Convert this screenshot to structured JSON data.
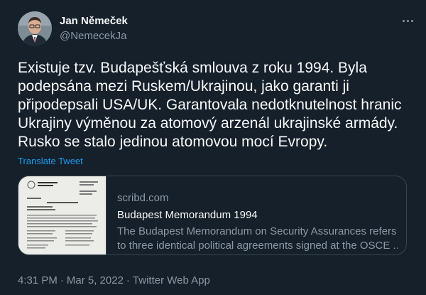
{
  "author": {
    "name": "Jan Němeček",
    "handle": "@NemecekJa"
  },
  "tweet": {
    "text": "Existuje tzv. Budapešťská smlouva z roku 1994. Byla podepsána mezi Ruskem/Ukrajinou, jako garanti ji připodepsali USA/UK. Garantovala nedotknutelnost hranic Ukrajiny výměnou za atomový arzenál ukrajinské armády. Rusko se stalo jedinou atomovou mocí Evropy.",
    "translate_label": "Translate Tweet"
  },
  "card": {
    "domain": "scribd.com",
    "title": "Budapest Memorandum 1994",
    "description_line1": "The Budapest Memorandum on Security Assurances refers",
    "description_line2": "to three identical political agreements signed at the OSCE ..."
  },
  "meta": {
    "time": "4:31 PM",
    "separator": "·",
    "date": "Mar 5, 2022",
    "source": "Twitter Web App"
  },
  "icons": {
    "more": "more-options-icon"
  },
  "colors": {
    "background": "#15202b",
    "text": "#f7f9f9",
    "secondary": "#8b98a5",
    "link": "#1d9bf0",
    "border": "#38444d"
  }
}
